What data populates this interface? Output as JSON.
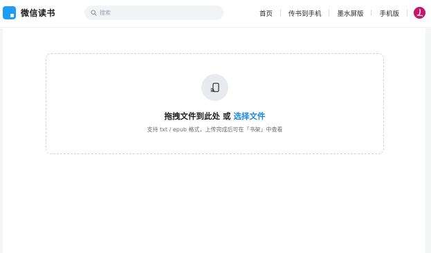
{
  "header": {
    "logo_text": "微信读书",
    "search": {
      "placeholder": "搜索"
    },
    "nav": [
      {
        "label": "首页"
      },
      {
        "label": "传书到手机"
      },
      {
        "label": "墨水屏版"
      },
      {
        "label": "手机版"
      }
    ],
    "avatar": "avatar"
  },
  "upload": {
    "icon": "cast-icon",
    "title_prefix": "拖拽文件到此处 或",
    "select_link": "选择文件",
    "hint": "支持 txt / epub 格式，上传完成后可在「书架」中查看"
  },
  "colors": {
    "brand": "#1f9cf5",
    "link": "#1e88e5",
    "avatar_bg": "#c2186b",
    "icon_circle": "#e9eaed",
    "dashed_border": "#cfd3da"
  }
}
